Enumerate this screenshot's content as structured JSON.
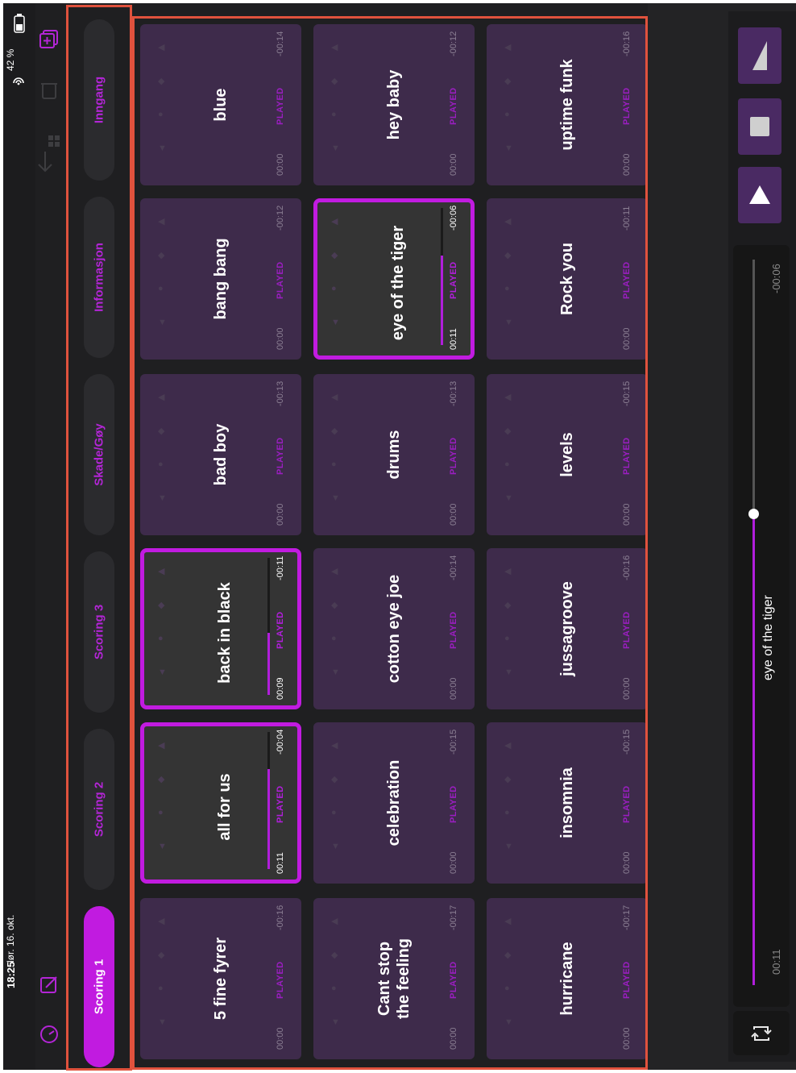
{
  "status_bar": {
    "time": "18:25",
    "date": "lør. 16. okt.",
    "battery": "42 %"
  },
  "toolbar_icons": [
    "speedometer-icon",
    "edit-icon",
    "import-icon",
    "trash-icon",
    "add-page-icon"
  ],
  "tabs": [
    {
      "label": "Scoring 1",
      "active": true
    },
    {
      "label": "Scoring 2",
      "active": false
    },
    {
      "label": "Scoring 3",
      "active": false
    },
    {
      "label": "Skade/Gøy",
      "active": false
    },
    {
      "label": "Informasjon",
      "active": false
    },
    {
      "label": "Inngang",
      "active": false
    }
  ],
  "tiles": [
    {
      "title": "5 fine fyrer",
      "elapsed": "00:00",
      "played": "PLAYED",
      "remaining": "-00:16",
      "playing": false,
      "progress": 0
    },
    {
      "title": "all for us",
      "elapsed": "00:11",
      "played": "PLAYED",
      "remaining": "-00:04",
      "playing": true,
      "progress": 0.73
    },
    {
      "title": "back in black",
      "elapsed": "00:09",
      "played": "PLAYED",
      "remaining": "-00:11",
      "playing": true,
      "progress": 0.45
    },
    {
      "title": "bad boy",
      "elapsed": "00:00",
      "played": "PLAYED",
      "remaining": "-00:13",
      "playing": false,
      "progress": 0
    },
    {
      "title": "bang bang",
      "elapsed": "00:00",
      "played": "PLAYED",
      "remaining": "-00:12",
      "playing": false,
      "progress": 0
    },
    {
      "title": "blue",
      "elapsed": "00:00",
      "played": "PLAYED",
      "remaining": "-00:14",
      "playing": false,
      "progress": 0
    },
    {
      "title": "Cant stop\nthe feeling",
      "elapsed": "00:00",
      "played": "PLAYED",
      "remaining": "-00:17",
      "playing": false,
      "progress": 0
    },
    {
      "title": "celebration",
      "elapsed": "00:00",
      "played": "PLAYED",
      "remaining": "-00:15",
      "playing": false,
      "progress": 0
    },
    {
      "title": "cotton eye joe",
      "elapsed": "00:00",
      "played": "PLAYED",
      "remaining": "-00:14",
      "playing": false,
      "progress": 0
    },
    {
      "title": "drums",
      "elapsed": "00:00",
      "played": "PLAYED",
      "remaining": "-00:13",
      "playing": false,
      "progress": 0
    },
    {
      "title": "eye of the tiger",
      "elapsed": "00:11",
      "played": "PLAYED",
      "remaining": "-00:06",
      "playing": true,
      "progress": 0.65
    },
    {
      "title": "hey baby",
      "elapsed": "00:00",
      "played": "PLAYED",
      "remaining": "-00:12",
      "playing": false,
      "progress": 0
    },
    {
      "title": "hurricane",
      "elapsed": "00:00",
      "played": "PLAYED",
      "remaining": "-00:17",
      "playing": false,
      "progress": 0
    },
    {
      "title": "insomnia",
      "elapsed": "00:00",
      "played": "PLAYED",
      "remaining": "-00:15",
      "playing": false,
      "progress": 0
    },
    {
      "title": "jussagroove",
      "elapsed": "00:00",
      "played": "PLAYED",
      "remaining": "-00:16",
      "playing": false,
      "progress": 0
    },
    {
      "title": "levels",
      "elapsed": "00:00",
      "played": "PLAYED",
      "remaining": "-00:15",
      "playing": false,
      "progress": 0
    },
    {
      "title": "Rock you",
      "elapsed": "00:00",
      "played": "PLAYED",
      "remaining": "-00:11",
      "playing": false,
      "progress": 0
    },
    {
      "title": "uptime funk",
      "elapsed": "00:00",
      "played": "PLAYED",
      "remaining": "-00:16",
      "playing": false,
      "progress": 0
    }
  ],
  "now_playing": {
    "title": "eye of the tiger",
    "elapsed": "00:11",
    "remaining": "-00:06",
    "progress": 0.65
  },
  "controls": [
    "fade-icon",
    "stop-icon",
    "play-icon"
  ],
  "colors": {
    "accent": "#c11be0",
    "tile": "#3e2b4b",
    "tile_playing": "#343434",
    "background": "#1f1f21",
    "highlight_outline": "#e0523d"
  }
}
